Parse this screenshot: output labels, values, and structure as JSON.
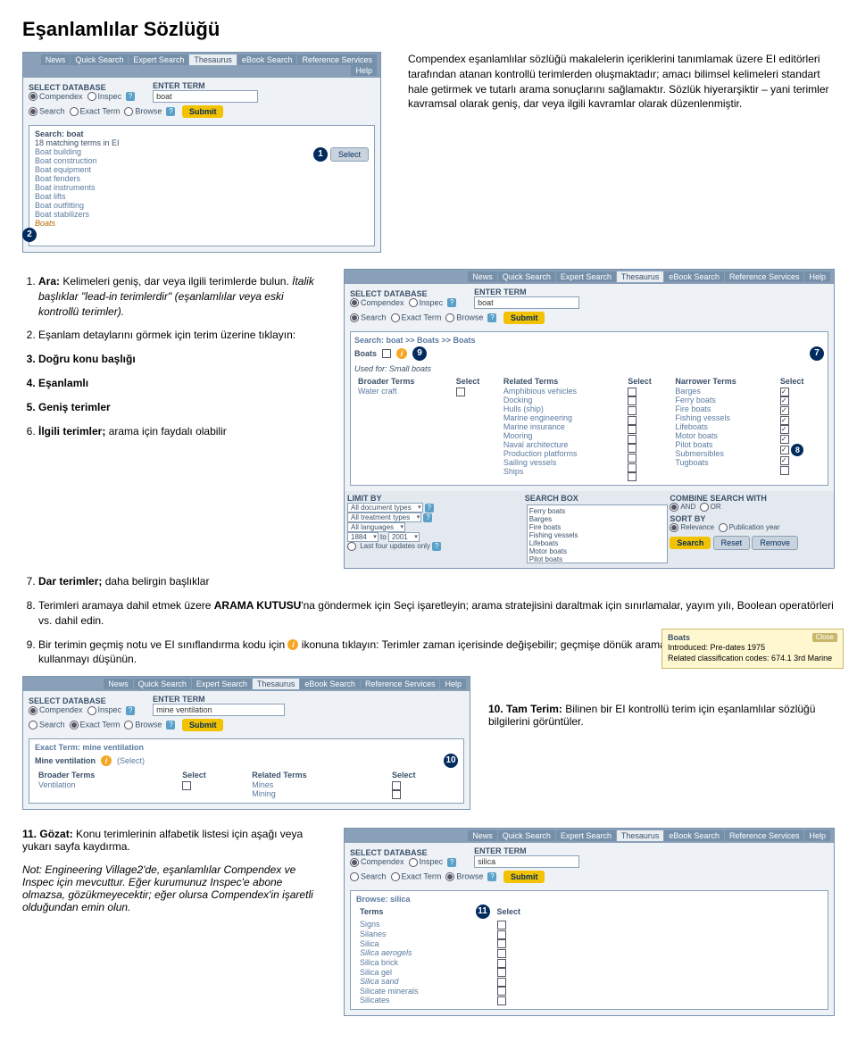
{
  "page_title": "Eşanlamlılar Sözlüğü",
  "intro": "Compendex eşanlamlılar sözlüğü makalelerin içeriklerini tanımlamak üzere EI editörleri tarafından atanan kontrollü terimlerden oluşmaktadır; amacı bilimsel kelimeleri standart hale getirmek ve tutarlı arama sonuçlarını sağlamaktır. Sözlük hiyerarşiktir – yani terimler kavramsal olarak geniş, dar veya ilgili kavramlar olarak düzenlenmiştir.",
  "nav": {
    "items": [
      "News",
      "Quick Search",
      "Expert Search",
      "Thesaurus",
      "eBook Search",
      "Reference Services",
      "Help"
    ],
    "active": "Thesaurus"
  },
  "labels": {
    "select_db": "SELECT DATABASE",
    "enter_term": "ENTER TERM",
    "submit": "Submit",
    "select_btn": "Select",
    "search": "Search",
    "exact_term": "Exact Term",
    "browse": "Browse",
    "compendex": "Compendex",
    "inspec": "Inspec",
    "limit_by": "LIMIT BY",
    "searchbox_label": "SEARCH BOX",
    "combine": "COMBINE SEARCH WITH",
    "and": "AND",
    "or": "OR",
    "sort_by": "SORT BY",
    "relevance": "Relevance",
    "pubyear": "Publication year",
    "reset": "Reset",
    "remove": "Remove",
    "search_btn": "Search",
    "close": "Close",
    "to": "to",
    "all_doc_types": "All document types",
    "all_treatment": "All treatment types",
    "all_lang": "All languages",
    "last_results_only": "Last four updates only",
    "year_from": "1884",
    "year_to": "2001"
  },
  "panel1": {
    "term_input": "boat",
    "search_header": "Search: boat",
    "match_line": "18 matching terms in EI",
    "results": [
      "Boat building",
      "Boat construction",
      "Boat equipment",
      "Boat fenders",
      "Boat instruments",
      "Boat lifts",
      "Boat outfitting",
      "Boat stabilizers",
      "Boats"
    ],
    "callout1": "1",
    "callout2": "2"
  },
  "panel2": {
    "term_input": "boat",
    "search_header": "Search: boat >> Boats >> Boats",
    "sub_header": "Used for: Small boats",
    "col_broader": "Broader Terms",
    "col_related": "Related Terms",
    "col_narrower": "Narrower Terms",
    "col_select": "Select",
    "broader": [
      "Water craft"
    ],
    "related": [
      "Amphibious vehicles",
      "Docking",
      "Hulls (ship)",
      "Marine engineering",
      "Marine insurance",
      "Mooring",
      "Naval architecture",
      "Production platforms",
      "Sailing vessels",
      "Ships"
    ],
    "narrower": [
      "Barges",
      "Ferry boats",
      "Fire boats",
      "Fishing vessels",
      "Lifeboats",
      "Motor boats",
      "Pilot boats",
      "Submersibles",
      "Tugboats"
    ],
    "searchbox_items": [
      "Ferry boats",
      "Barges",
      "Fire boats",
      "Fishing vessels",
      "Lifeboats",
      "Motor boats",
      "Pilot boats"
    ],
    "callout7": "7",
    "callout8": "8",
    "callout9": "9"
  },
  "list": {
    "i1_bold": "Ara:",
    "i1": " Kelimeleri geniş, dar veya ilgili terimlerde bulun. ",
    "i1_italic": "İtalik başlıklar \"lead-in terimlerdir\" (eşanlamlılar veya eski kontrollü terimler).",
    "i2": "Eşanlam detaylarını görmek için terim üzerine tıklayın:",
    "i3": "Doğru konu başlığı",
    "i4": "Eşanlamlı",
    "i5": "Geniş terimler",
    "i6": "İlgili terimler; arama için faydalı olabilir",
    "i7": "Dar terimler; daha belirgin başlıklar",
    "i8_a": "Terimleri aramaya dahil etmek üzere ",
    "i8_b": "ARAMA KUTUSU",
    "i8_c": "'na göndermek için Seçi işaretleyin; arama stratejisini daraltmak için sınırlamalar, yayım yılı, Boolean operatörleri vs. dahil edin.",
    "i9_a": "Bir terimin geçmiş notu ve EI sınıflandırma kodu için ",
    "i9_b": " ikonuna tıklayın: Terimler zaman içerisinde değişebilir; geçmişe dönük aramalar için eski ve yeni başlıkları kullanmayı düşünün."
  },
  "tooltip": {
    "title": "Boats",
    "line1": "Introduced: Pre-dates 1975",
    "line2": "Related classification codes: 674.1  3rd Marine"
  },
  "panel3": {
    "term_input": "mine ventilation",
    "exact_header": "Exact Term: mine ventilation",
    "main_term": "Mine ventilation",
    "used_for": "(Select)",
    "col_broader": "Broader Terms",
    "col_related": "Related Terms",
    "col_select": "Select",
    "broader": [
      "Ventilation"
    ],
    "related": [
      "Mines",
      "Mining"
    ],
    "callout10": "10"
  },
  "item10_bold": "Tam Terim:",
  "item10": " Bilinen bir EI kontrollü terim için eşanlamlılar sözlüğü bilgilerini görüntüler.",
  "panel4": {
    "term_input": "silica",
    "browse_header": "Browse: silica",
    "col_terms": "Terms",
    "col_select": "Select",
    "terms": [
      "Signs",
      "Silanes",
      "Silica",
      "Silica aerogels",
      "Silica brick",
      "Silica gel",
      "Silica sand",
      "Silicate minerals",
      "Silicates"
    ],
    "callout11": "11"
  },
  "item11_bold": "Gözat:",
  "item11": " Konu terimlerinin alfabetik listesi için aşağı veya yukarı sayfa kaydırma.",
  "note": "Not: Engineering Village2'de, eşanlamlılar Compendex ve Inspec için mevcuttur. Eğer kurumunuz Inspec'e abone olmazsa, gözükmeyecektir; eğer olursa Compendex'in işaretli olduğundan emin olun."
}
